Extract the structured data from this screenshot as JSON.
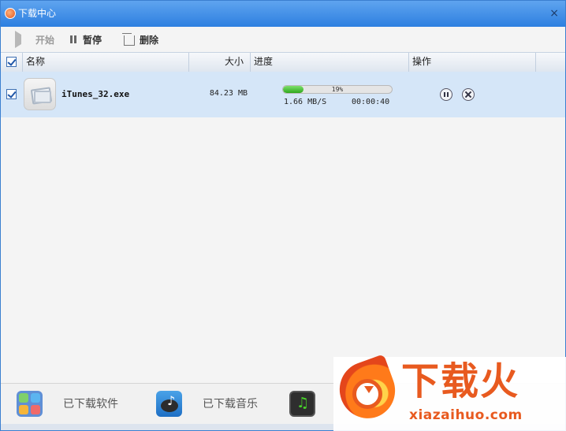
{
  "window": {
    "title": "下载中心",
    "close_label": "×"
  },
  "toolbar": {
    "start_label": "开始",
    "pause_label": "暂停",
    "delete_label": "删除"
  },
  "table": {
    "headers": {
      "name": "名称",
      "size": "大小",
      "progress": "进度",
      "actions": "操作"
    },
    "rows": [
      {
        "name": "iTunes_32.exe",
        "size": "84.23 MB",
        "progress_percent": 19,
        "progress_label": "19%",
        "speed": "1.66 MB/S",
        "remaining_time": "00:00:40",
        "checked": true
      }
    ]
  },
  "bottombar": {
    "downloaded_software_label": "已下载软件",
    "downloaded_music_label": "已下载音乐"
  },
  "watermark": {
    "brand": "下载火",
    "url": "xiazaihuo.com"
  },
  "colors": {
    "titlebar": "#3b8ae6",
    "row_selected": "#d5e6f8",
    "progress": "#2fa81e",
    "watermark": "#e85a1f"
  }
}
